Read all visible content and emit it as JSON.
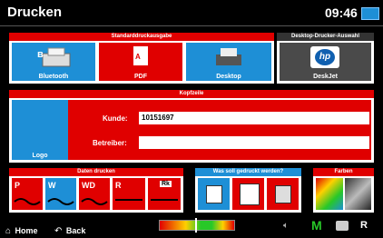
{
  "app": {
    "title": "Drucken",
    "clock": "09:46"
  },
  "sections": {
    "stand": {
      "title": "Standarddruckausgabe",
      "items": [
        {
          "label": "Bluetooth"
        },
        {
          "label": "PDF"
        },
        {
          "label": "Desktop"
        }
      ]
    },
    "desktop": {
      "title": "Desktop-Drucker-Auswahl",
      "item": {
        "label": "DeskJet"
      }
    },
    "kopf": {
      "title": "Kopfzeile",
      "logo_label": "Logo",
      "kunde_label": "Kunde:",
      "kunde_value": "10151697",
      "betreiber_label": "Betreiber:",
      "betreiber_value": ""
    },
    "daten": {
      "title": "Daten drucken",
      "items": [
        "P",
        "W",
        "WD",
        "R",
        "Rk"
      ]
    },
    "was": {
      "title": "Was soll gedruckt werden?"
    },
    "farben": {
      "title": "Farben"
    }
  },
  "bottom": {
    "home": "Home",
    "back": "Back",
    "mode": "M",
    "r_label": "R"
  },
  "colors": {
    "red": "#e00000",
    "blue": "#1e8fd6",
    "gray": "#4a4a4a"
  }
}
